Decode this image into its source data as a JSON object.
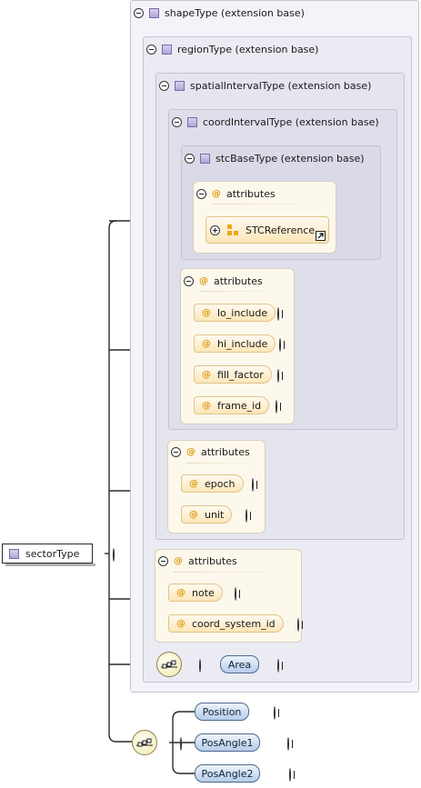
{
  "root": {
    "label": "sectorType"
  },
  "extensions": {
    "shape": "shapeType (extension base)",
    "region": "regionType (extension base)",
    "spatial": "spatialIntervalType (extension base)",
    "coord": "coordIntervalType (extension base)",
    "stc": "stcBaseType (extension base)"
  },
  "groups": {
    "stc": {
      "title": "attributes",
      "items": [
        "STCReference"
      ]
    },
    "coord": {
      "title": "attributes",
      "items": [
        "lo_include",
        "hi_include",
        "fill_factor",
        "frame_id"
      ]
    },
    "spatial": {
      "title": "attributes",
      "items": [
        "epoch",
        "unit"
      ]
    },
    "region": {
      "title": "attributes",
      "items": [
        "note",
        "coord_system_id"
      ]
    }
  },
  "elements": {
    "shape": [
      "Area"
    ],
    "sector": [
      "Position",
      "PosAngle1",
      "PosAngle2"
    ]
  },
  "icons": {
    "toggle": "collapse-toggle-icon",
    "expand": "expand-toggle-icon",
    "type": "complex-type-icon",
    "attribute": "attribute-icon",
    "reference": "attribute-group-reference-icon",
    "link": "link-arrow-icon",
    "sequence": "sequence-compositor-icon"
  },
  "symbols": {
    "attribute": "@"
  },
  "colors": {
    "attribute_marker": "#e09a10",
    "element_fill": "#b6ccea",
    "group_fill": "#fdf8ec",
    "type_icon": "#b2a6d6"
  }
}
